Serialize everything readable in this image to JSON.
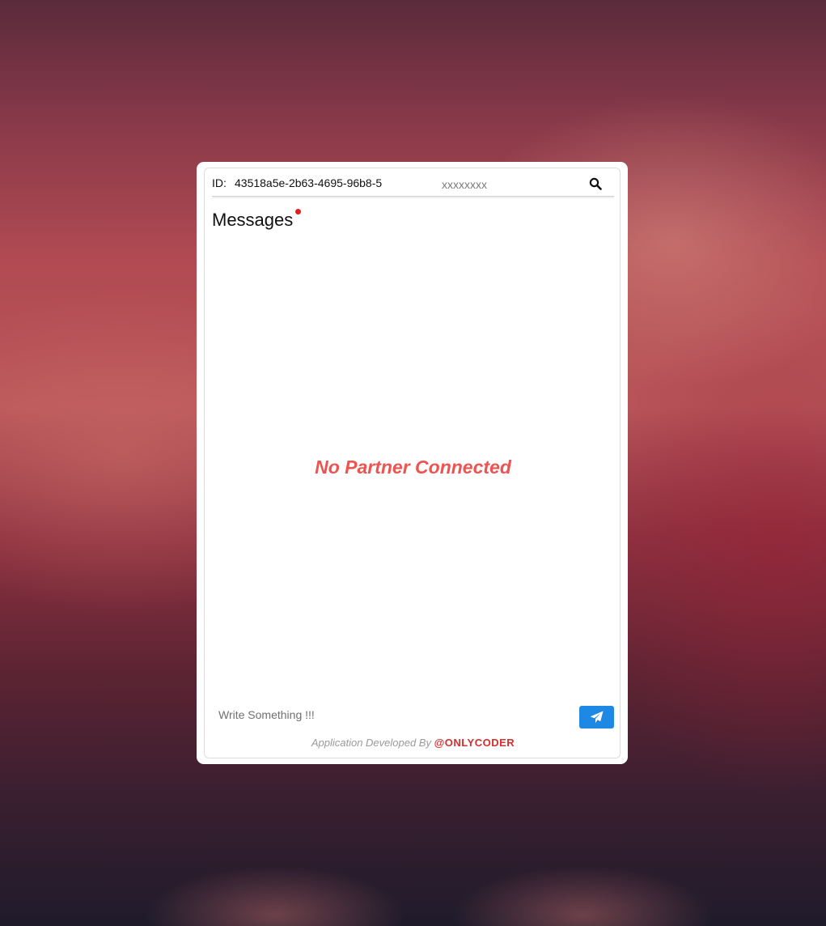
{
  "header": {
    "id_label": "ID:",
    "id_value": "43518a5e-2b63-4695-96b8-5",
    "partner_input_placeholder": "xxxxxxxx",
    "search_icon": "search-icon"
  },
  "messages": {
    "title": "Messages",
    "has_notification": true,
    "empty_state": "No Partner Connected"
  },
  "composer": {
    "placeholder": "Write Something !!!",
    "send_icon": "paper-plane-icon"
  },
  "footer": {
    "text": "Application Developed By",
    "brand": "@ONLYCODER"
  },
  "colors": {
    "accent": "#1e88e5",
    "empty_state": "#ef5350",
    "brand": "#d32f2f",
    "notification": "#e11d1d"
  }
}
